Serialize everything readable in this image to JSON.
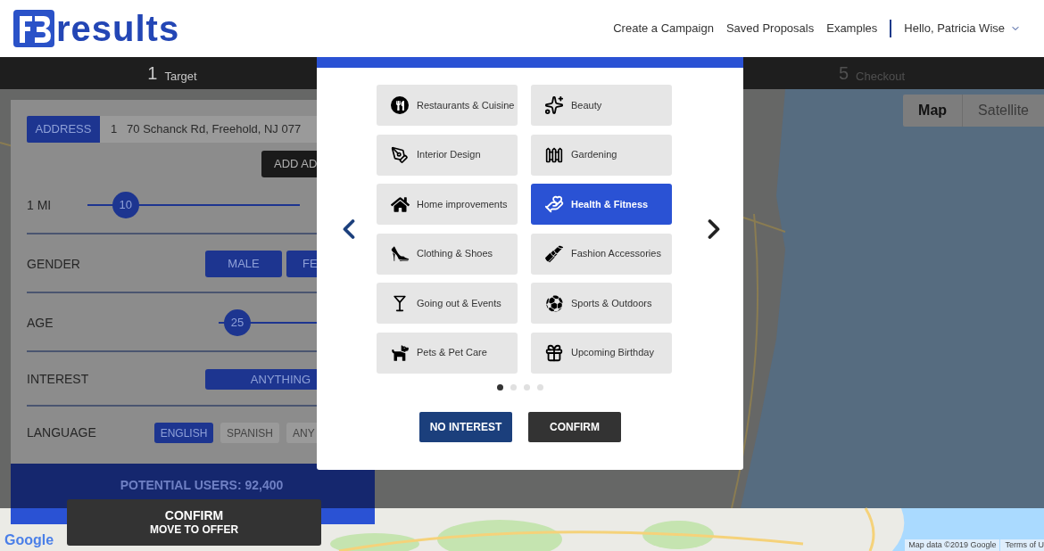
{
  "header": {
    "logo_text": "results",
    "nav": [
      "Create a Campaign",
      "Saved Proposals",
      "Examples"
    ],
    "user": "Hello, Patricia Wise"
  },
  "steps": [
    {
      "number": "1",
      "label": "Target",
      "active": true
    },
    {
      "number": "5",
      "label": "Checkout",
      "active": false
    }
  ],
  "panel": {
    "address_label": "ADDRESS",
    "address_value": "1   70 Schanck Rd, Freehold, NJ 077",
    "add_button": "ADD AD",
    "radius": {
      "label": "1 MI",
      "value": "10",
      "level": 0.18
    },
    "gender": {
      "label": "GENDER",
      "options": [
        {
          "label": "MALE",
          "selected": true
        },
        {
          "label": "FE",
          "selected": true
        }
      ]
    },
    "age": {
      "label": "AGE",
      "value": "25",
      "level": 0.19
    },
    "interest": {
      "label": "INTEREST",
      "value": "ANYTHING"
    },
    "language": {
      "label": "LANGUAGE",
      "options": [
        {
          "label": "ENGLISH",
          "selected": true
        },
        {
          "label": "SPANISH",
          "selected": false
        },
        {
          "label": "ANY",
          "selected": false
        }
      ]
    },
    "potential_users": "POTENTIAL USERS: 92,400"
  },
  "confirm_button": {
    "title": "CONFIRM",
    "subtitle": "MOVE TO OFFER"
  },
  "map": {
    "types": [
      {
        "label": "Map",
        "selected": true
      },
      {
        "label": "Satellite",
        "selected": false
      }
    ],
    "logo": "Google",
    "attribution": "Map data ©2019 Google",
    "terms": "Terms of U"
  },
  "modal": {
    "interests": [
      {
        "label": "Restaurants & Cuisine",
        "selected": false
      },
      {
        "label": "Beauty",
        "selected": false
      },
      {
        "label": "Interior Design",
        "selected": false
      },
      {
        "label": "Gardening",
        "selected": false
      },
      {
        "label": "Home improvements",
        "selected": false
      },
      {
        "label": "Health & Fitness",
        "selected": true
      },
      {
        "label": "Clothing & Shoes",
        "selected": false
      },
      {
        "label": "Fashion Accessories",
        "selected": false
      },
      {
        "label": "Going out & Events",
        "selected": false
      },
      {
        "label": "Sports & Outdoors",
        "selected": false
      },
      {
        "label": "Pets & Pet Care",
        "selected": false
      },
      {
        "label": "Upcoming Birthday",
        "selected": false
      }
    ],
    "pages": [
      {
        "selected": true
      },
      {
        "selected": false
      },
      {
        "selected": false
      },
      {
        "selected": false
      }
    ],
    "no_interest": "NO INTEREST",
    "confirm": "CONFIRM"
  }
}
